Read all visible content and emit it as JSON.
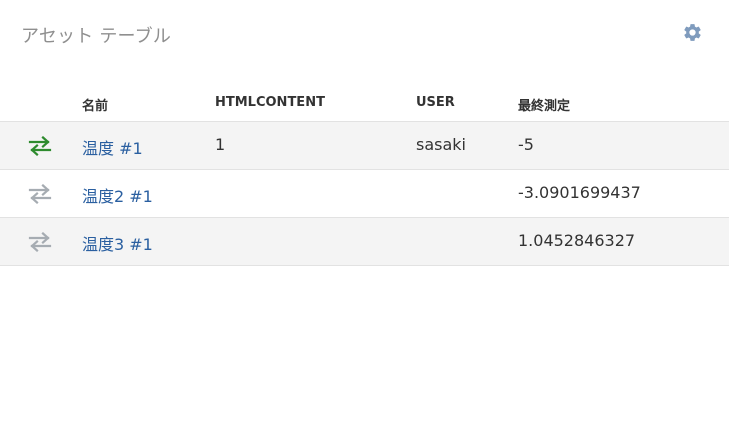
{
  "header": {
    "title": "アセット テーブル",
    "settings_icon": "gear-icon"
  },
  "table": {
    "columns": [
      "名前",
      "HTMLCONTENT",
      "USER",
      "最終測定"
    ],
    "rows": [
      {
        "status_icon": "sync-arrows-icon",
        "status_color": "#2e8b2e",
        "name": "温度 #1",
        "htmlcontent": "1",
        "user": "sasaki",
        "last_measurement": "-5"
      },
      {
        "status_icon": "sync-arrows-icon",
        "status_color": "#a6acb2",
        "name": "温度2 #1",
        "htmlcontent": "",
        "user": "",
        "last_measurement": "-3.0901699437"
      },
      {
        "status_icon": "sync-arrows-icon",
        "status_color": "#a6acb2",
        "name": "温度3 #1",
        "htmlcontent": "",
        "user": "",
        "last_measurement": "1.0452846327"
      }
    ]
  },
  "colors": {
    "title": "#8f8f8f",
    "link": "#2a5fa0",
    "gear": "#7f9bbd",
    "row_alt_bg": "#f4f4f4"
  }
}
